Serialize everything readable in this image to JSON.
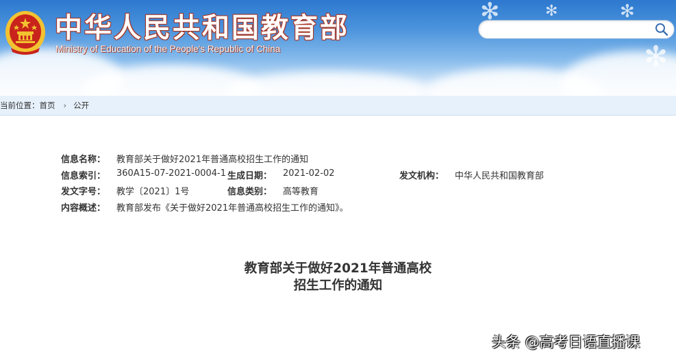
{
  "header": {
    "title": "中华人民共和国教育部",
    "subtitle": "Ministry of Education of the People's Republic of China",
    "search_placeholder": ""
  },
  "breadcrumb": {
    "prefix": "当前位置：",
    "items": [
      "首页",
      "公开"
    ]
  },
  "info": {
    "name_label": "信息名称：",
    "name_value": "教育部关于做好2021年普通高校招生工作的通知",
    "index_label": "信息索引：",
    "index_value": "360A15-07-2021-0004-1",
    "date_label": "生成日期：",
    "date_value": "2021-02-02",
    "org_label": "发文机构：",
    "org_value": "中华人民共和国教育部",
    "docno_label": "发文字号：",
    "docno_value": "教学〔2021〕1号",
    "category_label": "信息类别：",
    "category_value": "高等教育",
    "summary_label": "内容概述：",
    "summary_value": "教育部发布《关于做好2021年普通高校招生工作的通知》。"
  },
  "article": {
    "title_line1": "教育部关于做好2021年普通高校",
    "title_line2": "招生工作的通知"
  },
  "watermark": {
    "text": "头条 @高考日语直播课"
  },
  "colors": {
    "header_blue": "#2d79cf",
    "emblem_red": "#c8241b",
    "emblem_gold": "#f3c230",
    "text": "#333333"
  }
}
